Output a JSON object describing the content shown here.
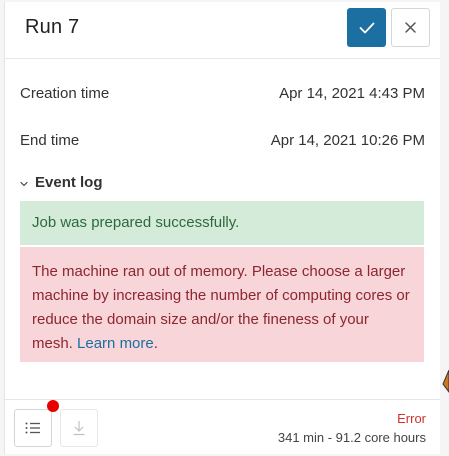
{
  "header": {
    "title": "Run 7"
  },
  "details": {
    "creation_label": "Creation time",
    "creation_value": "Apr 14, 2021 4:43 PM",
    "end_label": "End time",
    "end_value": "Apr 14, 2021 10:26 PM"
  },
  "event_log": {
    "label": "Event log",
    "success_message": "Job was prepared successfully.",
    "error_message": "The machine ran out of memory. Please choose a larger machine by increasing the number of computing cores or reduce the domain size and/or the fineness of your mesh.",
    "error_link": "Learn more",
    "error_suffix": "."
  },
  "footer": {
    "status": "Error",
    "duration": "341 min - 91.2 core hours"
  },
  "colors": {
    "primary": "#1b6fa1",
    "success_bg": "#d4ebda",
    "error_bg": "#f8d5d8",
    "error_text": "#d0312d",
    "notification": "#e60000"
  }
}
